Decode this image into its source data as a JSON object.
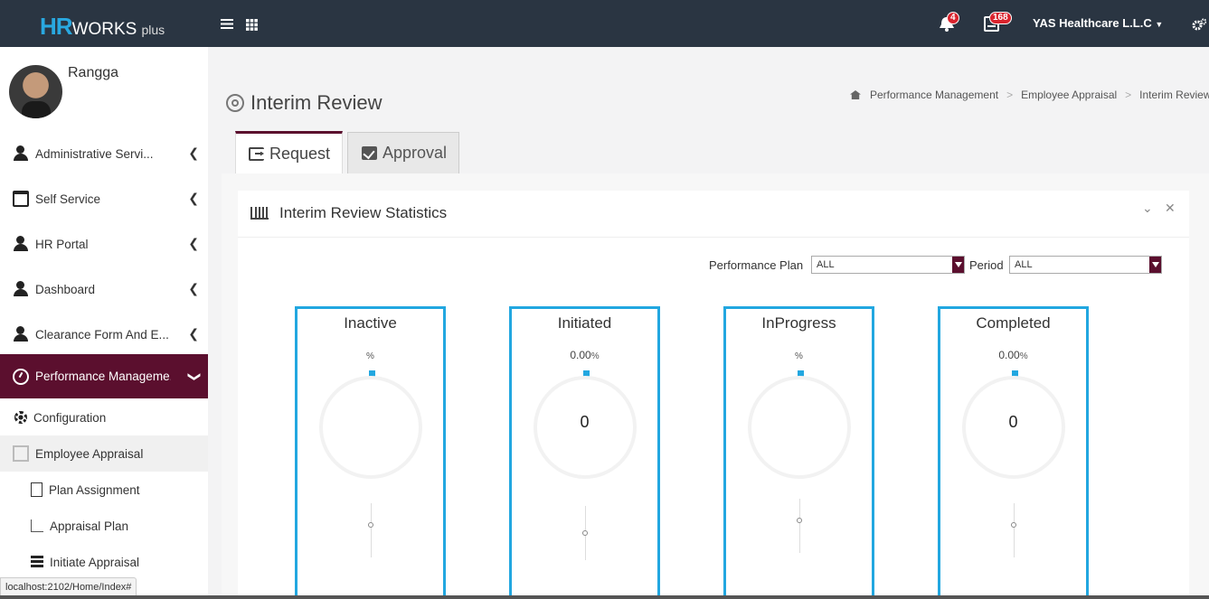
{
  "app": {
    "logo_hr": "HR",
    "logo_works": "WORKS",
    "logo_plus": "plus"
  },
  "topbar": {
    "notifications_count": "4",
    "messages_count": "168",
    "company": "YAS Healthcare L.L.C"
  },
  "user": {
    "name": "Rangga"
  },
  "sidebar": {
    "items": [
      {
        "label": "Administrative Servi...",
        "icon": "user-icon"
      },
      {
        "label": "Self Service",
        "icon": "window-icon"
      },
      {
        "label": "HR Portal",
        "icon": "user-tie-icon"
      },
      {
        "label": "Dashboard",
        "icon": "user-icon"
      },
      {
        "label": "Clearance Form And E...",
        "icon": "user-clearance-icon"
      },
      {
        "label": "Performance Manageme...",
        "icon": "dashboard-icon",
        "active": true
      }
    ],
    "sub_items": [
      {
        "label": "Configuration",
        "icon": "gear-icon"
      },
      {
        "label": "Employee Appraisal",
        "icon": "gift-icon",
        "selected": true
      }
    ],
    "appraisal_items": [
      {
        "label": "Plan Assignment",
        "icon": "document-icon"
      },
      {
        "label": "Appraisal Plan",
        "icon": "line-chart-icon"
      },
      {
        "label": "Initiate Appraisal",
        "icon": "list-icon"
      }
    ]
  },
  "status_url": "localhost:2102/Home/Index#",
  "page": {
    "title": "Interim Review",
    "breadcrumb": [
      "Performance Management",
      "Employee Appraisal",
      "Interim Review"
    ],
    "tabs": {
      "request": "Request",
      "approval": "Approval"
    }
  },
  "panel": {
    "title": "Interim Review Statistics",
    "filters": {
      "plan_label": "Performance Plan",
      "plan_value": "ALL",
      "period_label": "Period",
      "period_value": "ALL"
    },
    "cards": [
      {
        "title": "Inactive",
        "percent": "",
        "unit": "%",
        "count": "",
        "needle_label": "0"
      },
      {
        "title": "Initiated",
        "percent": "0.00",
        "unit": "%",
        "count": "0",
        "needle_label": "0"
      },
      {
        "title": "InProgress",
        "percent": "",
        "unit": "%",
        "count": "",
        "needle_label": "0"
      },
      {
        "title": "Completed",
        "percent": "0.00",
        "unit": "%",
        "count": "0",
        "needle_label": "0"
      }
    ]
  },
  "colors": {
    "topbar": "#2a3542",
    "accent": "#5b0f2e",
    "card_border": "#22a7e0",
    "logo_blue": "#29a8e0",
    "badge": "#d9232d"
  }
}
